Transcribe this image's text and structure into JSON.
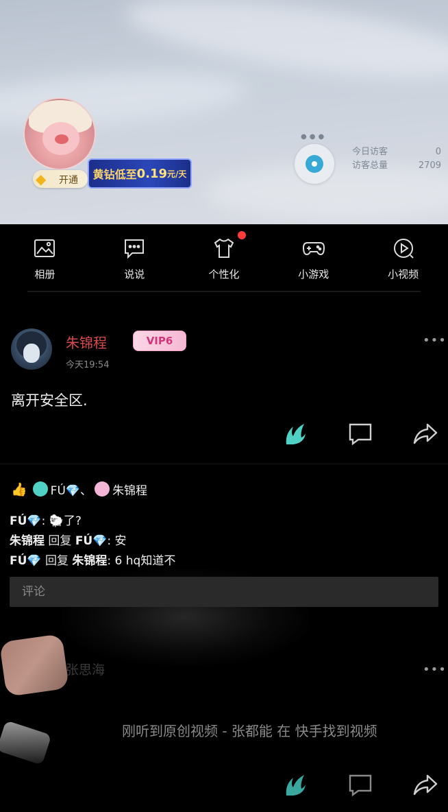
{
  "header": {
    "vip_open_label": "开通",
    "promo_prefix": "黄钻低至",
    "promo_price": "0.19",
    "promo_unit": "元/天",
    "stats": [
      {
        "label": "今日访客",
        "value": "0"
      },
      {
        "label": "访客总量",
        "value": "2709"
      }
    ]
  },
  "nav": [
    {
      "label": "相册",
      "icon": "photo-album-icon",
      "dot": false
    },
    {
      "label": "说说",
      "icon": "message-bubble-icon",
      "dot": false
    },
    {
      "label": "个性化",
      "icon": "tshirt-icon",
      "dot": true
    },
    {
      "label": "小游戏",
      "icon": "gamepad-icon",
      "dot": false
    },
    {
      "label": "小视频",
      "icon": "play-video-icon",
      "dot": false
    }
  ],
  "post": {
    "author": "朱锦程",
    "vip_label": "VIP6",
    "time": "今天19:54",
    "text": "离开安全区.",
    "likers_text": "FÚ💎、",
    "likers_last": "朱锦程",
    "comments": [
      {
        "name": "FÚ💎",
        "reply": "",
        "reply_to": "",
        "text": ": 🐑了?"
      },
      {
        "name": "朱锦程",
        "reply": "回复",
        "reply_to": "FÚ💎",
        "text": ": 安"
      },
      {
        "name": "FÚ💎",
        "reply": "回复",
        "reply_to": "朱锦程",
        "text": ": 6 hq知道不"
      }
    ],
    "comment_placeholder": "评论"
  },
  "post2": {
    "author": "张思海",
    "text": "刚听到原创视频 - 张都能 在 快手找到视频"
  },
  "colors": {
    "accent_teal": "#4fd1c5",
    "author_red": "#d94a4a",
    "notification_red": "#ff3b3b"
  }
}
